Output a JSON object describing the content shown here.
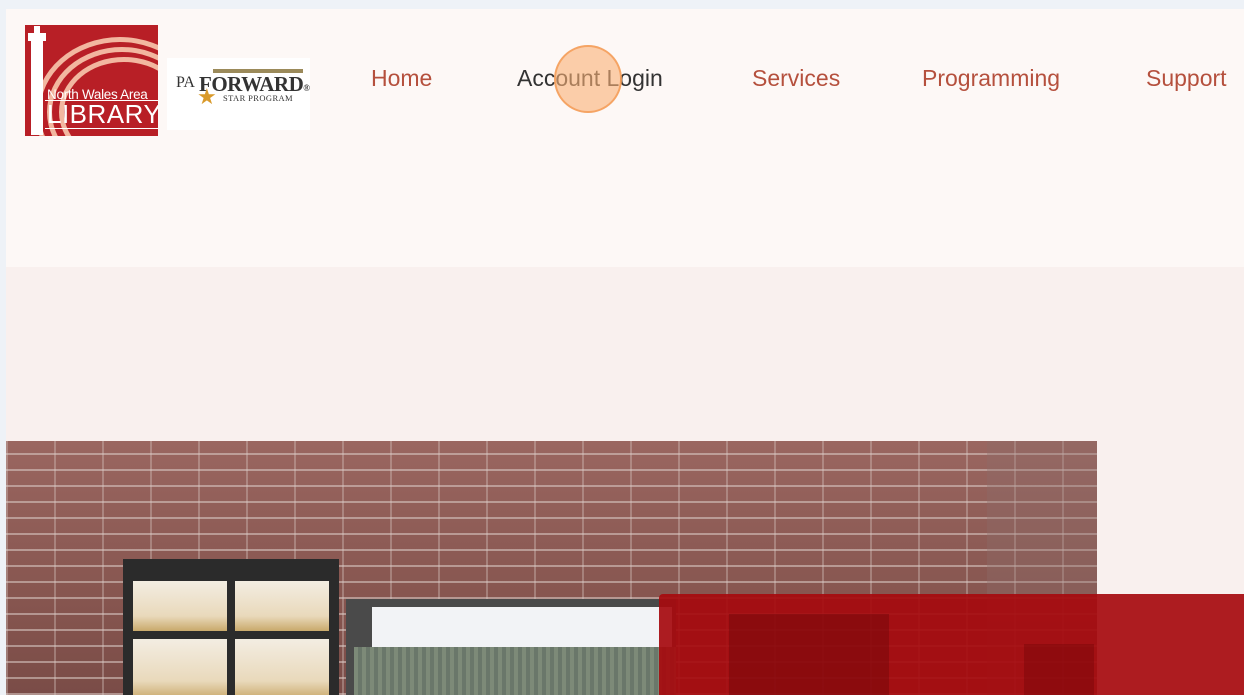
{
  "logos": {
    "nwal": {
      "line1": "North Wales Area",
      "line2": "LIBRARY"
    },
    "paf": {
      "pa": "PA",
      "forward": "FORWARD",
      "reg": "®",
      "sub": "STAR PROGRAM",
      "star": "★"
    }
  },
  "nav": {
    "items": [
      {
        "label": "Home"
      },
      {
        "label": "Account Login",
        "active": true
      },
      {
        "label": "Services"
      },
      {
        "label": "Programming"
      },
      {
        "label": "Support"
      }
    ]
  },
  "colors": {
    "nav_text": "#b5503d",
    "nav_active": "#333333",
    "brand_red": "#b81f26",
    "panel_red": "#a60a0e"
  }
}
